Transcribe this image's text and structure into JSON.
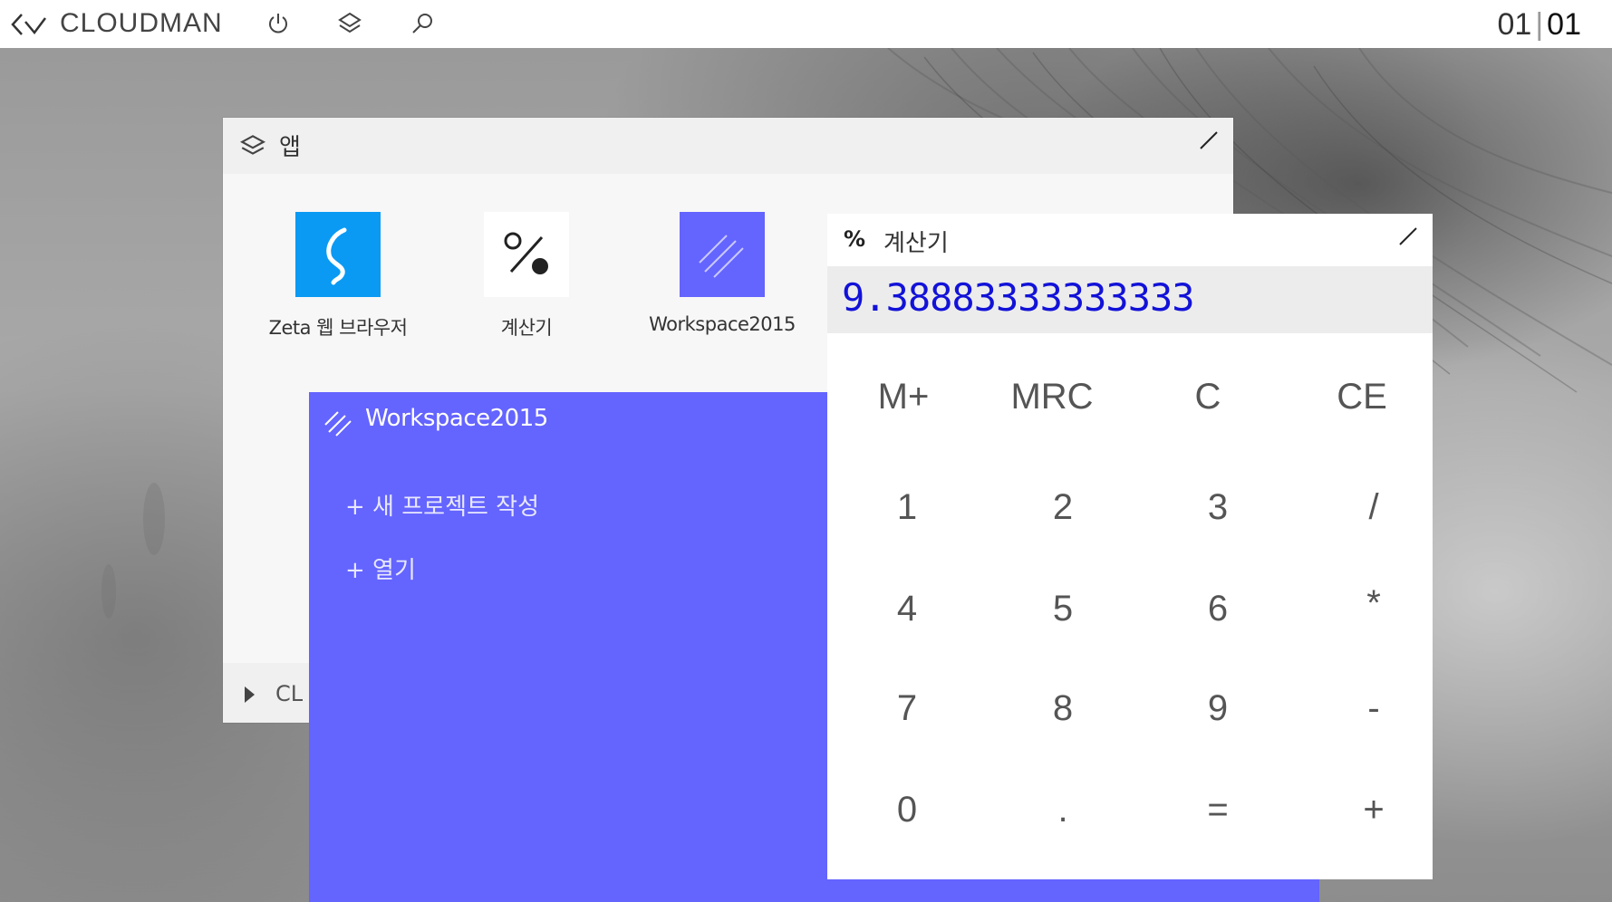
{
  "topbar": {
    "brand": "CLOUDMAN",
    "icons": [
      "back-chevron-icon",
      "power-icon",
      "layers-icon",
      "search-icon"
    ],
    "clock_hour": "01",
    "clock_sep": "|",
    "clock_min": "01"
  },
  "apps_window": {
    "title": "앱",
    "tiles": [
      {
        "label": "Zeta 웹 브라우저",
        "icon": "zeta-icon",
        "color": "#0a9af3"
      },
      {
        "label": "계산기",
        "icon": "percent-icon",
        "color": "#ffffff"
      },
      {
        "label": "Workspace2015",
        "icon": "workspace-icon",
        "color": "#6464ff"
      }
    ],
    "footer_label": "CL"
  },
  "workspace_window": {
    "title": "Workspace2015",
    "items": [
      "+  새 프로젝트 작성",
      "+  열기"
    ],
    "color": "#6464ff"
  },
  "calculator_window": {
    "icon": "%",
    "title": "계산기",
    "display": "9.38883333333333",
    "keys": [
      [
        "M+",
        "MRC",
        "C",
        "CE"
      ],
      [
        "1",
        "2",
        "3",
        "/"
      ],
      [
        "4",
        "5",
        "6",
        "*"
      ],
      [
        "7",
        "8",
        "9",
        "-"
      ],
      [
        "0",
        ".",
        "=",
        "+"
      ]
    ]
  }
}
